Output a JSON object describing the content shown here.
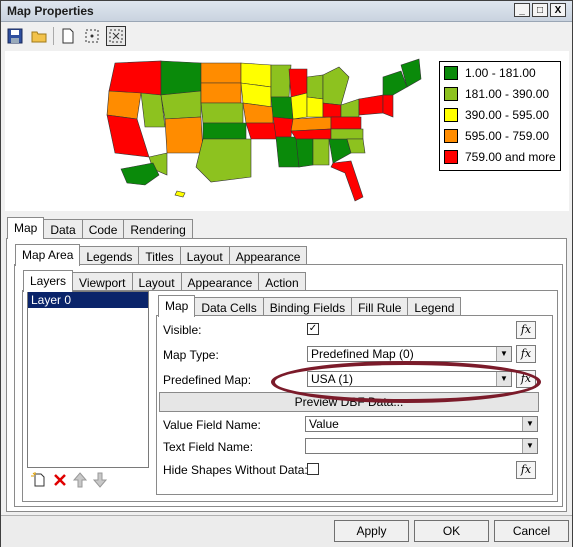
{
  "window": {
    "title": "Map Properties",
    "controls": [
      "_",
      "□",
      "X"
    ]
  },
  "toolbar": {
    "icons": [
      "save-icon",
      "open-folder-icon",
      "new-page-icon",
      "select-area-icon",
      "select-all-icon"
    ]
  },
  "legend": [
    {
      "label": "1.00 - 181.00",
      "color": "#0a8a0a"
    },
    {
      "label": "181.00 - 390.00",
      "color": "#8dc21f"
    },
    {
      "label": "390.00 - 595.00",
      "color": "#ffff00"
    },
    {
      "label": "595.00 - 759.00",
      "color": "#ff8c00"
    },
    {
      "label": "759.00 and more",
      "color": "#ff0000"
    }
  ],
  "tabs_main": [
    "Map",
    "Data",
    "Code",
    "Rendering"
  ],
  "tabs_sub": [
    "Map Area",
    "Legends",
    "Titles",
    "Layout",
    "Appearance"
  ],
  "tabs_sub2": [
    "Layers",
    "Viewport",
    "Layout",
    "Appearance",
    "Action"
  ],
  "layers": [
    "Layer 0"
  ],
  "tabs_prop": [
    "Map",
    "Data Cells",
    "Binding Fields",
    "Fill Rule",
    "Legend"
  ],
  "props": {
    "visible_label": "Visible:",
    "visible_checked": "✓",
    "map_type_label": "Map Type:",
    "map_type_value": "Predefined Map (0)",
    "predefined_label": "Predefined Map:",
    "predefined_value": "USA (1)",
    "preview_btn": "Preview DBF Data...",
    "value_field_label": "Value Field Name:",
    "value_field_value": "Value",
    "text_field_label": "Text Field Name:",
    "text_field_value": "",
    "hide_label": "Hide Shapes Without Data:"
  },
  "fx_label": "fx",
  "buttons": {
    "apply": "Apply",
    "ok": "OK",
    "cancel": "Cancel"
  }
}
